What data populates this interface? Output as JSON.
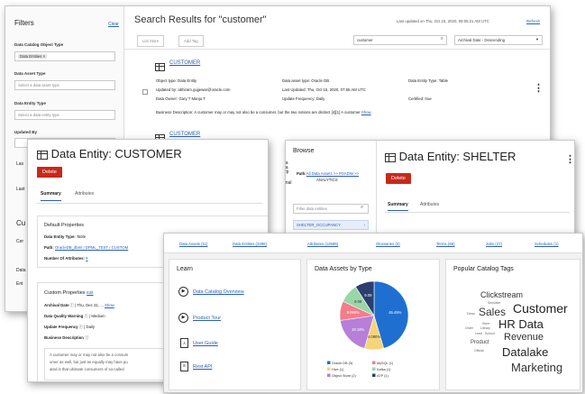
{
  "search": {
    "filters_title": "Filters",
    "clear": "Clear",
    "f1_label": "Data Catalog Object Type",
    "f1_chip": "Data Entities",
    "f2_label": "Data Asset Type",
    "f2_placeholder": "Select a data asset type",
    "f3_label": "Data Entity Type",
    "f3_placeholder": "Select a data entity type",
    "f4_label": "Updated By",
    "side_frags": [
      "Las",
      "Last",
      "Cu",
      "Cer",
      "Data",
      "Ent"
    ],
    "title": "Search Results for \"customer\"",
    "last_updated": "Last updated on Thu, Oct 15, 2020, 08:05:21 AM UTC",
    "refresh": "Refresh",
    "btn_list": "List Store",
    "btn_tag": "Add Tag",
    "search_value": "customer",
    "sort": "Archival Date - Descending",
    "r1": {
      "name": "CUSTOMER",
      "c1": [
        "Object type: Data Entity",
        "Updated by: abhiram.gujjewar@oracle.com",
        "Data Owner: Gary T Manju T"
      ],
      "c2": [
        "Data asset type: Oracle DB",
        "Last Updated: Thu, Oct 15, 2020, 07:55 AM UTC",
        "Update Frequency: Daily"
      ],
      "c3": [
        "Data Entity Type: Table",
        "",
        "Certified: true"
      ],
      "desc": "Business Description: A customer may or may not also be a consumer, but the two notions are distinct [4][1] A customer",
      "show": "Show"
    },
    "r2": {
      "name": "CUSTOMER"
    }
  },
  "entity": {
    "title": "Data Entity: CUSTOMER",
    "delete": "Delete",
    "tab1": "Summary",
    "tab2": "Attributes",
    "default_props": "Default Properties",
    "type_label": "Data Entity Type:",
    "type_value": "Table",
    "path_label": "Path:",
    "path_value": "OracleDB_dbml / DPML_TEST / CUSTOM",
    "num_label": "Number Of Attributes:",
    "num_value": "8",
    "custom_props": "Custom Properties",
    "edit": "Edit",
    "p1_label": "Archival Date",
    "p1_value": "Thu, Dec 31, ...",
    "p1_show": "Show",
    "p2_label": "Data Quality Warning",
    "p2_value": "Medium",
    "p3_label": "Update Frequency",
    "p3_value": "Daily",
    "p4_label": "Business Description",
    "desc_lines": [
      "A customer may or may not also be a consum",
      "umer as well, but just as equally may have pu",
      "ated is that ultimate consumers of so-called"
    ]
  },
  "browse": {
    "title": "Browse",
    "path_label": "Path:",
    "path_link": "All Data Assets >> PSADW >>",
    "path_tail": "ANALYTICS",
    "filter_placeholder": "Filter data entities",
    "item": "SHELTER_OCCUPANCY",
    "frags": [
      "La",
      "La",
      "Up",
      "anal"
    ]
  },
  "shelter": {
    "title": "Data Entity: SHELTER",
    "delete": "Delete",
    "tab1": "Summary",
    "tab2": "Attributes"
  },
  "home": {
    "stats": [
      "Data Assets (11)",
      "Data Entities (2296)",
      "Attributes (12586)",
      "Glossaries (3)",
      "Terms (66)",
      "Jobs (27)",
      "Schedules (1)"
    ],
    "learn_title": "Learn",
    "learn_items": [
      "Data Catalog Overview",
      "Product Tour",
      "User Guide",
      "Rest API"
    ],
    "assets_title": "Data Assets by Type",
    "tags_title": "Popular Catalog Tags",
    "tags": [
      {
        "t": "Clickstream",
        "c": "#333"
      },
      {
        "t": "Sensitive",
        "c": "#666"
      },
      {
        "t": "Desc",
        "c": "#666"
      },
      {
        "t": "Sales",
        "c": "#333"
      },
      {
        "t": "Customer",
        "c": "#222"
      },
      {
        "t": "Store",
        "c": "#666"
      },
      {
        "t": "Library",
        "c": "#666"
      },
      {
        "t": "Order",
        "c": "#666"
      },
      {
        "t": "HR Data",
        "c": "#222"
      },
      {
        "t": "Lead",
        "c": "#666"
      },
      {
        "t": "School",
        "c": "#666"
      },
      {
        "t": "Revenue",
        "c": "#333"
      },
      {
        "t": "Product",
        "c": "#444"
      },
      {
        "t": "Official",
        "c": "#666"
      },
      {
        "t": "Datalake",
        "c": "#222"
      },
      {
        "t": "Marketing",
        "c": "#333"
      }
    ]
  },
  "chart_data": {
    "type": "pie",
    "title": "Data Assets by Type",
    "slices": [
      {
        "name": "Oracle DB (5)",
        "value": 45.45,
        "label": "45.45%",
        "color": "#1f6fd1"
      },
      {
        "name": "Hive (1)",
        "value": 9.09,
        "label": "9.090%",
        "color": "#f5d47a"
      },
      {
        "name": "Object Store (2)",
        "value": 18.18,
        "label": "18.18%",
        "color": "#b77fd8"
      },
      {
        "name": "MySQL (1)",
        "value": 9.09,
        "label": "9.090%",
        "color": "#f27d8b"
      },
      {
        "name": "Kafka (1)",
        "value": 9.09,
        "label": "9.09",
        "color": "#9ad6a8"
      },
      {
        "name": "ATP (1)",
        "value": 9.09,
        "label": "9.09",
        "color": "#2c3e6e"
      }
    ]
  }
}
